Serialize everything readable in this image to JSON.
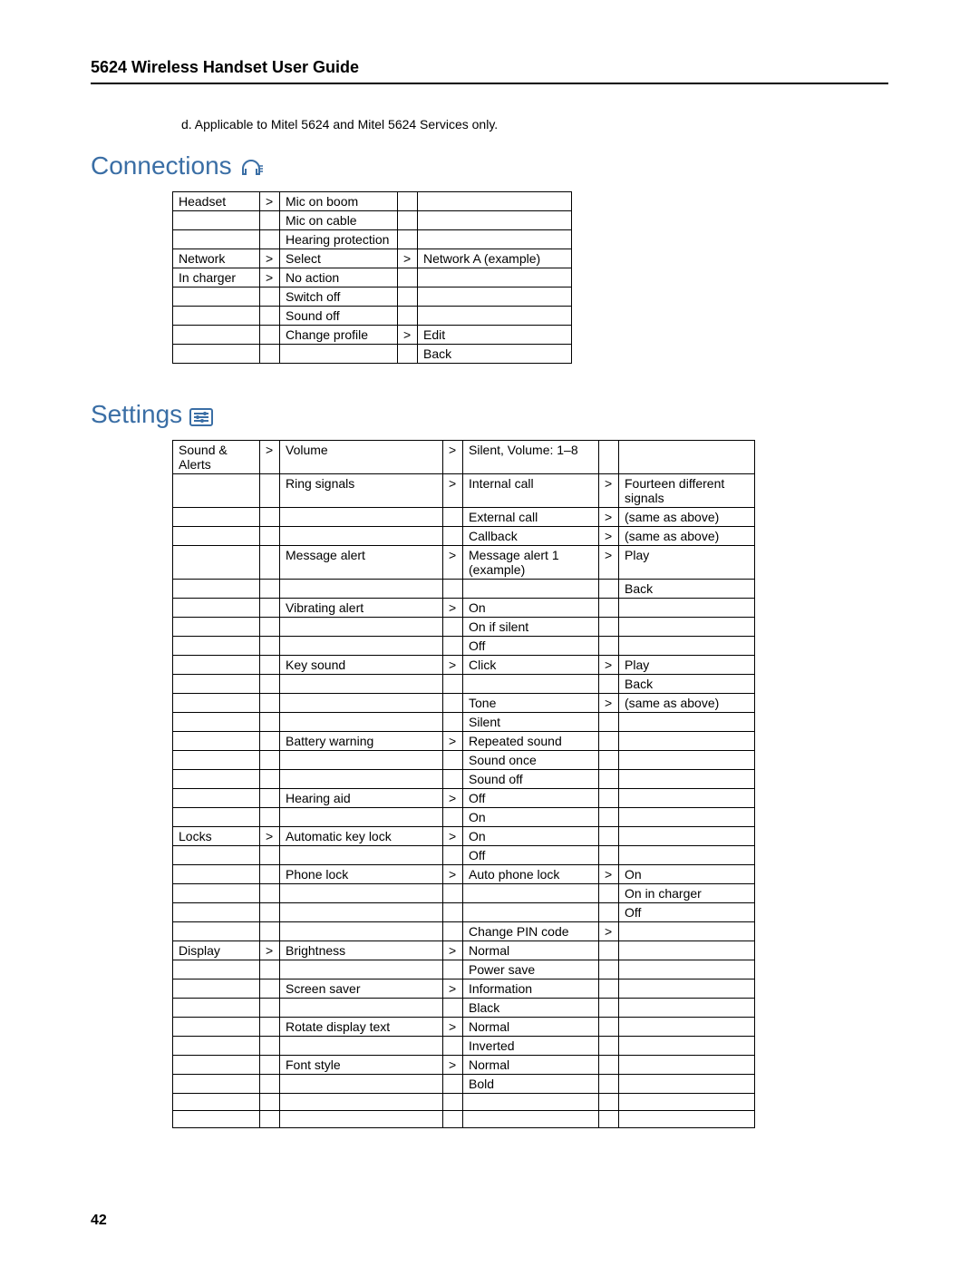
{
  "doc_title": "5624 Wireless Handset User Guide",
  "footnote": "d. Applicable to Mitel 5624 and Mitel 5624 Services only.",
  "page_number": "42",
  "gt": ">",
  "connections": {
    "heading": "Connections",
    "rows": [
      {
        "c0": "Headset",
        "g0": ">",
        "c1": "Mic on boom",
        "g1": "",
        "c2": ""
      },
      {
        "c0": "",
        "g0": "",
        "c1": "Mic on cable",
        "g1": "",
        "c2": ""
      },
      {
        "c0": "",
        "g0": "",
        "c1": "Hearing protection",
        "g1": "",
        "c2": ""
      },
      {
        "c0": "Network",
        "g0": ">",
        "c1": "Select",
        "g1": ">",
        "c2": "Network A (example)"
      },
      {
        "c0": "In charger",
        "g0": ">",
        "c1": "No action",
        "g1": "",
        "c2": ""
      },
      {
        "c0": "",
        "g0": "",
        "c1": "Switch off",
        "g1": "",
        "c2": ""
      },
      {
        "c0": "",
        "g0": "",
        "c1": "Sound off",
        "g1": "",
        "c2": ""
      },
      {
        "c0": "",
        "g0": "",
        "c1": "Change profile",
        "g1": ">",
        "c2": "Edit"
      },
      {
        "c0": "",
        "g0": "",
        "c1": "",
        "g1": "",
        "c2": "Back"
      }
    ]
  },
  "settings": {
    "heading": "Settings",
    "rows": [
      {
        "c0": "Sound & Alerts",
        "g0": ">",
        "c1": "Volume",
        "g1": ">",
        "c2": "Silent, Volume: 1–8",
        "g2": "",
        "c3": ""
      },
      {
        "c0": "",
        "g0": "",
        "c1": "Ring signals",
        "g1": ">",
        "c2": "Internal call",
        "g2": ">",
        "c3": "Fourteen different signals"
      },
      {
        "c0": "",
        "g0": "",
        "c1": "",
        "g1": "",
        "c2": "External call",
        "g2": ">",
        "c3": "(same as above)"
      },
      {
        "c0": "",
        "g0": "",
        "c1": "",
        "g1": "",
        "c2": "Callback",
        "g2": ">",
        "c3": "(same as above)"
      },
      {
        "c0": "",
        "g0": "",
        "c1": "Message alert",
        "g1": ">",
        "c2": "Message alert 1 (example)",
        "g2": ">",
        "c3": "Play"
      },
      {
        "c0": "",
        "g0": "",
        "c1": "",
        "g1": "",
        "c2": "",
        "g2": "",
        "c3": "Back"
      },
      {
        "c0": "",
        "g0": "",
        "c1": "Vibrating alert",
        "g1": ">",
        "c2": "On",
        "g2": "",
        "c3": ""
      },
      {
        "c0": "",
        "g0": "",
        "c1": "",
        "g1": "",
        "c2": "On if silent",
        "g2": "",
        "c3": ""
      },
      {
        "c0": "",
        "g0": "",
        "c1": "",
        "g1": "",
        "c2": "Off",
        "g2": "",
        "c3": ""
      },
      {
        "c0": "",
        "g0": "",
        "c1": "Key sound",
        "g1": ">",
        "c2": "Click",
        "g2": ">",
        "c3": "Play"
      },
      {
        "c0": "",
        "g0": "",
        "c1": "",
        "g1": "",
        "c2": "",
        "g2": "",
        "c3": "Back"
      },
      {
        "c0": "",
        "g0": "",
        "c1": "",
        "g1": "",
        "c2": "Tone",
        "g2": ">",
        "c3": "(same as above)"
      },
      {
        "c0": "",
        "g0": "",
        "c1": "",
        "g1": "",
        "c2": "Silent",
        "g2": "",
        "c3": ""
      },
      {
        "c0": "",
        "g0": "",
        "c1": "Battery warning",
        "g1": ">",
        "c2": "Repeated sound",
        "g2": "",
        "c3": ""
      },
      {
        "c0": "",
        "g0": "",
        "c1": "",
        "g1": "",
        "c2": "Sound once",
        "g2": "",
        "c3": ""
      },
      {
        "c0": "",
        "g0": "",
        "c1": "",
        "g1": "",
        "c2": "Sound off",
        "g2": "",
        "c3": ""
      },
      {
        "c0": "",
        "g0": "",
        "c1": "Hearing aid",
        "g1": ">",
        "c2": "Off",
        "g2": "",
        "c3": ""
      },
      {
        "c0": "",
        "g0": "",
        "c1": "",
        "g1": "",
        "c2": "On",
        "g2": "",
        "c3": ""
      },
      {
        "c0": "Locks",
        "g0": ">",
        "c1": "Automatic key lock",
        "g1": ">",
        "c2": "On",
        "g2": "",
        "c3": ""
      },
      {
        "c0": "",
        "g0": "",
        "c1": "",
        "g1": "",
        "c2": "Off",
        "g2": "",
        "c3": ""
      },
      {
        "c0": "",
        "g0": "",
        "c1": "Phone lock",
        "g1": ">",
        "c2": "Auto phone lock",
        "g2": ">",
        "c3": "On"
      },
      {
        "c0": "",
        "g0": "",
        "c1": "",
        "g1": "",
        "c2": "",
        "g2": "",
        "c3": "On in charger"
      },
      {
        "c0": "",
        "g0": "",
        "c1": "",
        "g1": "",
        "c2": "",
        "g2": "",
        "c3": "Off"
      },
      {
        "c0": "",
        "g0": "",
        "c1": "",
        "g1": "",
        "c2": "Change PIN code",
        "g2": ">",
        "c3": ""
      },
      {
        "c0": "Display",
        "g0": ">",
        "c1": "Brightness",
        "g1": ">",
        "c2": "Normal",
        "g2": "",
        "c3": ""
      },
      {
        "c0": "",
        "g0": "",
        "c1": "",
        "g1": "",
        "c2": "Power save",
        "g2": "",
        "c3": ""
      },
      {
        "c0": "",
        "g0": "",
        "c1": "Screen saver",
        "g1": ">",
        "c2": "Information",
        "g2": "",
        "c3": ""
      },
      {
        "c0": "",
        "g0": "",
        "c1": "",
        "g1": "",
        "c2": "Black",
        "g2": "",
        "c3": ""
      },
      {
        "c0": "",
        "g0": "",
        "c1": "Rotate display text",
        "g1": ">",
        "c2": "Normal",
        "g2": "",
        "c3": ""
      },
      {
        "c0": "",
        "g0": "",
        "c1": "",
        "g1": "",
        "c2": "Inverted",
        "g2": "",
        "c3": ""
      },
      {
        "c0": "",
        "g0": "",
        "c1": "Font style",
        "g1": ">",
        "c2": "Normal",
        "g2": "",
        "c3": ""
      },
      {
        "c0": "",
        "g0": "",
        "c1": "",
        "g1": "",
        "c2": "Bold",
        "g2": "",
        "c3": ""
      },
      {
        "c0": "",
        "g0": "",
        "c1": "",
        "g1": "",
        "c2": "",
        "g2": "",
        "c3": ""
      },
      {
        "c0": "",
        "g0": "",
        "c1": "",
        "g1": "",
        "c2": "",
        "g2": "",
        "c3": ""
      }
    ]
  }
}
